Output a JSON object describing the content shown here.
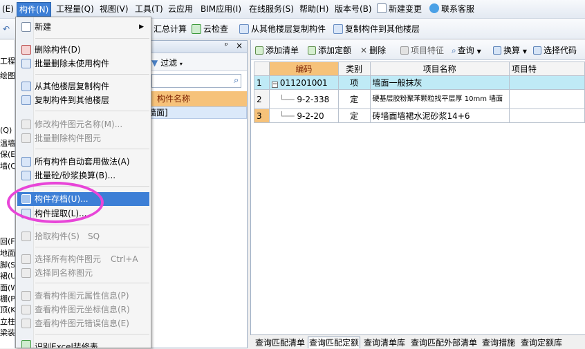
{
  "menubar": {
    "items": [
      "(E)",
      "构件(N)",
      "工程量(Q)",
      "视图(V)",
      "工具(T)",
      "云应用",
      "BIM应用(I)",
      "在线服务(S)",
      "帮助(H)",
      "版本号(B)",
      "新建变更",
      "联系客服"
    ]
  },
  "toolbar": {
    "summary": "汇总计算",
    "cloud_check": "云检查",
    "copy_from_floor": "从其他楼层复制构件",
    "copy_to_floor": "复制构件到其他楼层"
  },
  "left_strip": {
    "items": [
      "工程设",
      "绘图输",
      "(Q)",
      "温墙",
      "保(E)",
      "墙(Q)",
      "回(F)",
      "地面",
      "脚(S)",
      "裙(U)",
      "面(W)",
      "棚(P)",
      "顶(K)",
      "立柱装",
      "梁装饰"
    ]
  },
  "mid_panel": {
    "pin": "ᵖ",
    "close": "×",
    "filter_label": "过滤",
    "column_header": "构件名称",
    "row1": "墙面]"
  },
  "right_panel": {
    "toolbar": {
      "add_list": "添加清单",
      "add_quota": "添加定额",
      "delete": "删除",
      "item_feature": "项目特征",
      "query": "查询",
      "convert": "换算",
      "select_code": "选择代码"
    },
    "table": {
      "headers": [
        "编码",
        "类别",
        "项目名称",
        "项目特"
      ],
      "rows": [
        {
          "num": "1",
          "code": "011201001",
          "type": "项",
          "name": "墙面一般抹灰"
        },
        {
          "num": "2",
          "code": "9-2-338",
          "type": "定",
          "name": "硬基层胶粉聚苯颗粒找平层厚 10mm 墙面"
        },
        {
          "num": "3",
          "code": "9-2-20",
          "type": "定",
          "name": "砖墙面墙裙水泥砂浆14+6"
        }
      ]
    },
    "bottom_tabs": [
      "查询匹配清单",
      "查询匹配定额",
      "查询清单库",
      "查询匹配外部清单",
      "查询措施",
      "查询定额库"
    ]
  },
  "dropdown": {
    "items": [
      {
        "label": "新建",
        "submenu": true,
        "disabled": false
      },
      {
        "label": "删除构件(D)",
        "disabled": false
      },
      {
        "label": "批量删除未使用构件",
        "disabled": false
      },
      {
        "label": "从其他楼层复制构件",
        "disabled": false
      },
      {
        "label": "复制构件到其他楼层",
        "disabled": false
      },
      {
        "label": "修改构件图元名称(M)...",
        "disabled": true
      },
      {
        "label": "批量删除构件图元",
        "disabled": true
      },
      {
        "label": "所有构件自动套用做法(A)",
        "disabled": false
      },
      {
        "label": "批量砼/砂浆换算(B)...",
        "disabled": false
      },
      {
        "label": "构件存档(U)...",
        "disabled": false
      },
      {
        "label": "构件提取(L)...",
        "disabled": false
      },
      {
        "label": "拾取构件(S)",
        "shortcut": "SQ",
        "disabled": true
      },
      {
        "label": "选择所有构件图元",
        "shortcut": "Ctrl+A",
        "disabled": true
      },
      {
        "label": "选择同名称图元",
        "disabled": true
      },
      {
        "label": "查看构件图元属性信息(P)",
        "disabled": true
      },
      {
        "label": "查看构件图元坐标信息(R)",
        "disabled": true
      },
      {
        "label": "查看构件图元错误信息(E)",
        "disabled": true
      },
      {
        "label": "识别Excel装修表",
        "disabled": false
      }
    ]
  },
  "colors": {
    "menu_highlight": "#3d7fd6",
    "annotation_circle": "#e845d8",
    "code_header": "#f6c27a",
    "selected_row": "#bfeaf6"
  }
}
